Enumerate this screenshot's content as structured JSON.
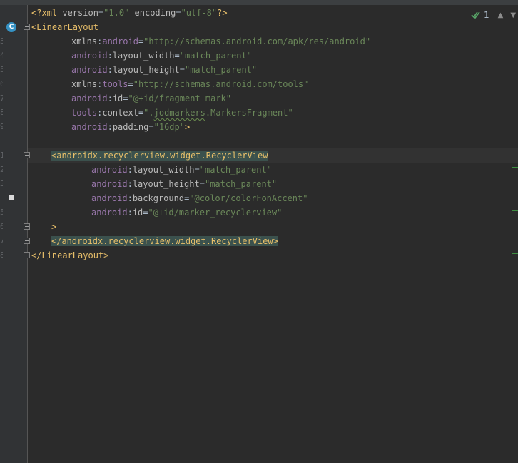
{
  "editor": {
    "inspection_count": "1",
    "lines": {
      "l1": {
        "open": "<?xml ",
        "version_attr": "version",
        "version_eq": "=",
        "version_val": "\"1.0\"",
        "encoding_attr": " encoding",
        "encoding_eq": "=",
        "encoding_val": "\"utf-8\"",
        "close": "?>"
      },
      "l2": {
        "tag": "<LinearLayout"
      },
      "l3": {
        "ns1": "xmlns",
        "colon": ":",
        "ns2": "android",
        "eq": "=",
        "val": "\"http://schemas.android.com/apk/res/android\""
      },
      "l4": {
        "ns": "android",
        "colon": ":",
        "attr": "layout_width",
        "eq": "=",
        "val": "\"match_parent\""
      },
      "l5": {
        "ns": "android",
        "colon": ":",
        "attr": "layout_height",
        "eq": "=",
        "val": "\"match_parent\""
      },
      "l6": {
        "ns1": "xmlns",
        "colon": ":",
        "ns2": "tools",
        "eq": "=",
        "val": "\"http://schemas.android.com/tools\""
      },
      "l7": {
        "ns": "android",
        "colon": ":",
        "attr": "id",
        "eq": "=",
        "val": "\"@+id/fragment_mark\""
      },
      "l8": {
        "ns": "tools",
        "colon": ":",
        "attr": "context",
        "eq": "=",
        "val_a": "\".",
        "val_b": "jodmarkers",
        "val_c": ".MarkersFragment\""
      },
      "l9": {
        "ns": "android",
        "colon": ":",
        "attr": "padding",
        "eq": "=",
        "val": "\"16dp\"",
        "close": ">"
      },
      "l11": {
        "tag": "<androidx.recyclerview.widget.RecyclerView"
      },
      "l12": {
        "ns": "android",
        "colon": ":",
        "attr": "layout_width",
        "eq": "=",
        "val": "\"match_parent\""
      },
      "l13": {
        "ns": "android",
        "colon": ":",
        "attr": "layout_height",
        "eq": "=",
        "val": "\"match_parent\""
      },
      "l14": {
        "ns": "android",
        "colon": ":",
        "attr": "background",
        "eq": "=",
        "val": "\"@color/colorFonAccent\""
      },
      "l15": {
        "ns": "android",
        "colon": ":",
        "attr": "id",
        "eq": "=",
        "val": "\"@+id/marker_recyclerview\""
      },
      "l16": {
        "tag": ">"
      },
      "l17": {
        "tag": "</androidx.recyclerview.widget.RecyclerView>"
      },
      "l18": {
        "tag": "</LinearLayout>"
      }
    }
  }
}
